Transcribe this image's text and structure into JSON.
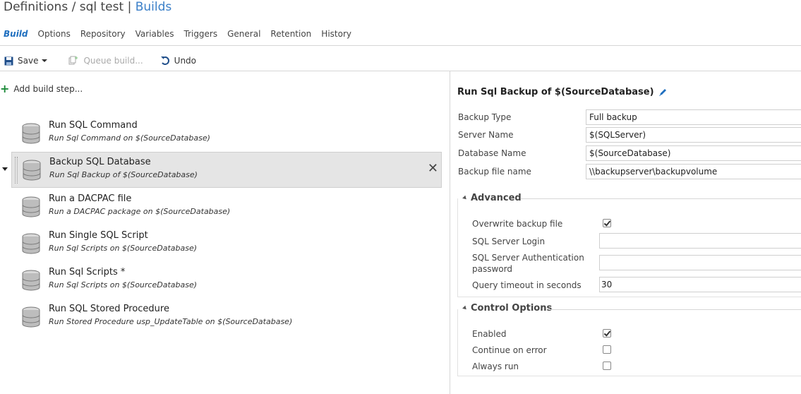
{
  "breadcrumb": {
    "definitions": "Definitions",
    "separator": "/",
    "name": "sql test",
    "pipe": "|",
    "current": "Builds"
  },
  "tabs": [
    "Build",
    "Options",
    "Repository",
    "Variables",
    "Triggers",
    "General",
    "Retention",
    "History"
  ],
  "toolbar": {
    "save": "Save",
    "queue": "Queue build...",
    "undo": "Undo"
  },
  "add_step": "Add build step...",
  "steps": [
    {
      "title": "Run SQL Command",
      "subtitle": "Run Sql Command on $(SourceDatabase)"
    },
    {
      "title": "Backup SQL Database",
      "subtitle": "Run Sql Backup of $(SourceDatabase)"
    },
    {
      "title": "Run a DACPAC file",
      "subtitle": "Run a DACPAC package on $(SourceDatabase)"
    },
    {
      "title": "Run Single SQL Script",
      "subtitle": "Run Sql Scripts on $(SourceDatabase)"
    },
    {
      "title": "Run Sql Scripts *",
      "subtitle": "Run Sql Scripts on $(SourceDatabase)"
    },
    {
      "title": "Run SQL Stored Procedure",
      "subtitle": "Run Stored Procedure usp_UpdateTable on $(SourceDatabase)"
    }
  ],
  "selected_step": 1,
  "detail": {
    "title": "Run Sql Backup of $(SourceDatabase)",
    "fields": [
      {
        "label": "Backup Type",
        "value": "Full backup"
      },
      {
        "label": "Server Name",
        "value": "$(SQLServer)"
      },
      {
        "label": "Database Name",
        "value": "$(SourceDatabase)"
      },
      {
        "label": "Backup file name",
        "value": "\\\\backupserver\\backupvolume"
      }
    ],
    "advanced": {
      "heading": "Advanced",
      "overwrite_label": "Overwrite backup file",
      "overwrite_checked": true,
      "login_label": "SQL Server Login",
      "login_value": "",
      "password_label_1": "SQL Server Authentication",
      "password_label_2": "password",
      "password_value": "",
      "timeout_label": "Query timeout in seconds",
      "timeout_value": "30"
    },
    "control": {
      "heading": "Control Options",
      "enabled_label": "Enabled",
      "enabled_checked": true,
      "continue_label": "Continue on error",
      "continue_checked": false,
      "always_label": "Always run",
      "always_checked": false
    }
  },
  "colors": {
    "accent": "#1f6fbf",
    "add_green": "#1d8a3a",
    "selected_bg": "#e5e5e5"
  }
}
